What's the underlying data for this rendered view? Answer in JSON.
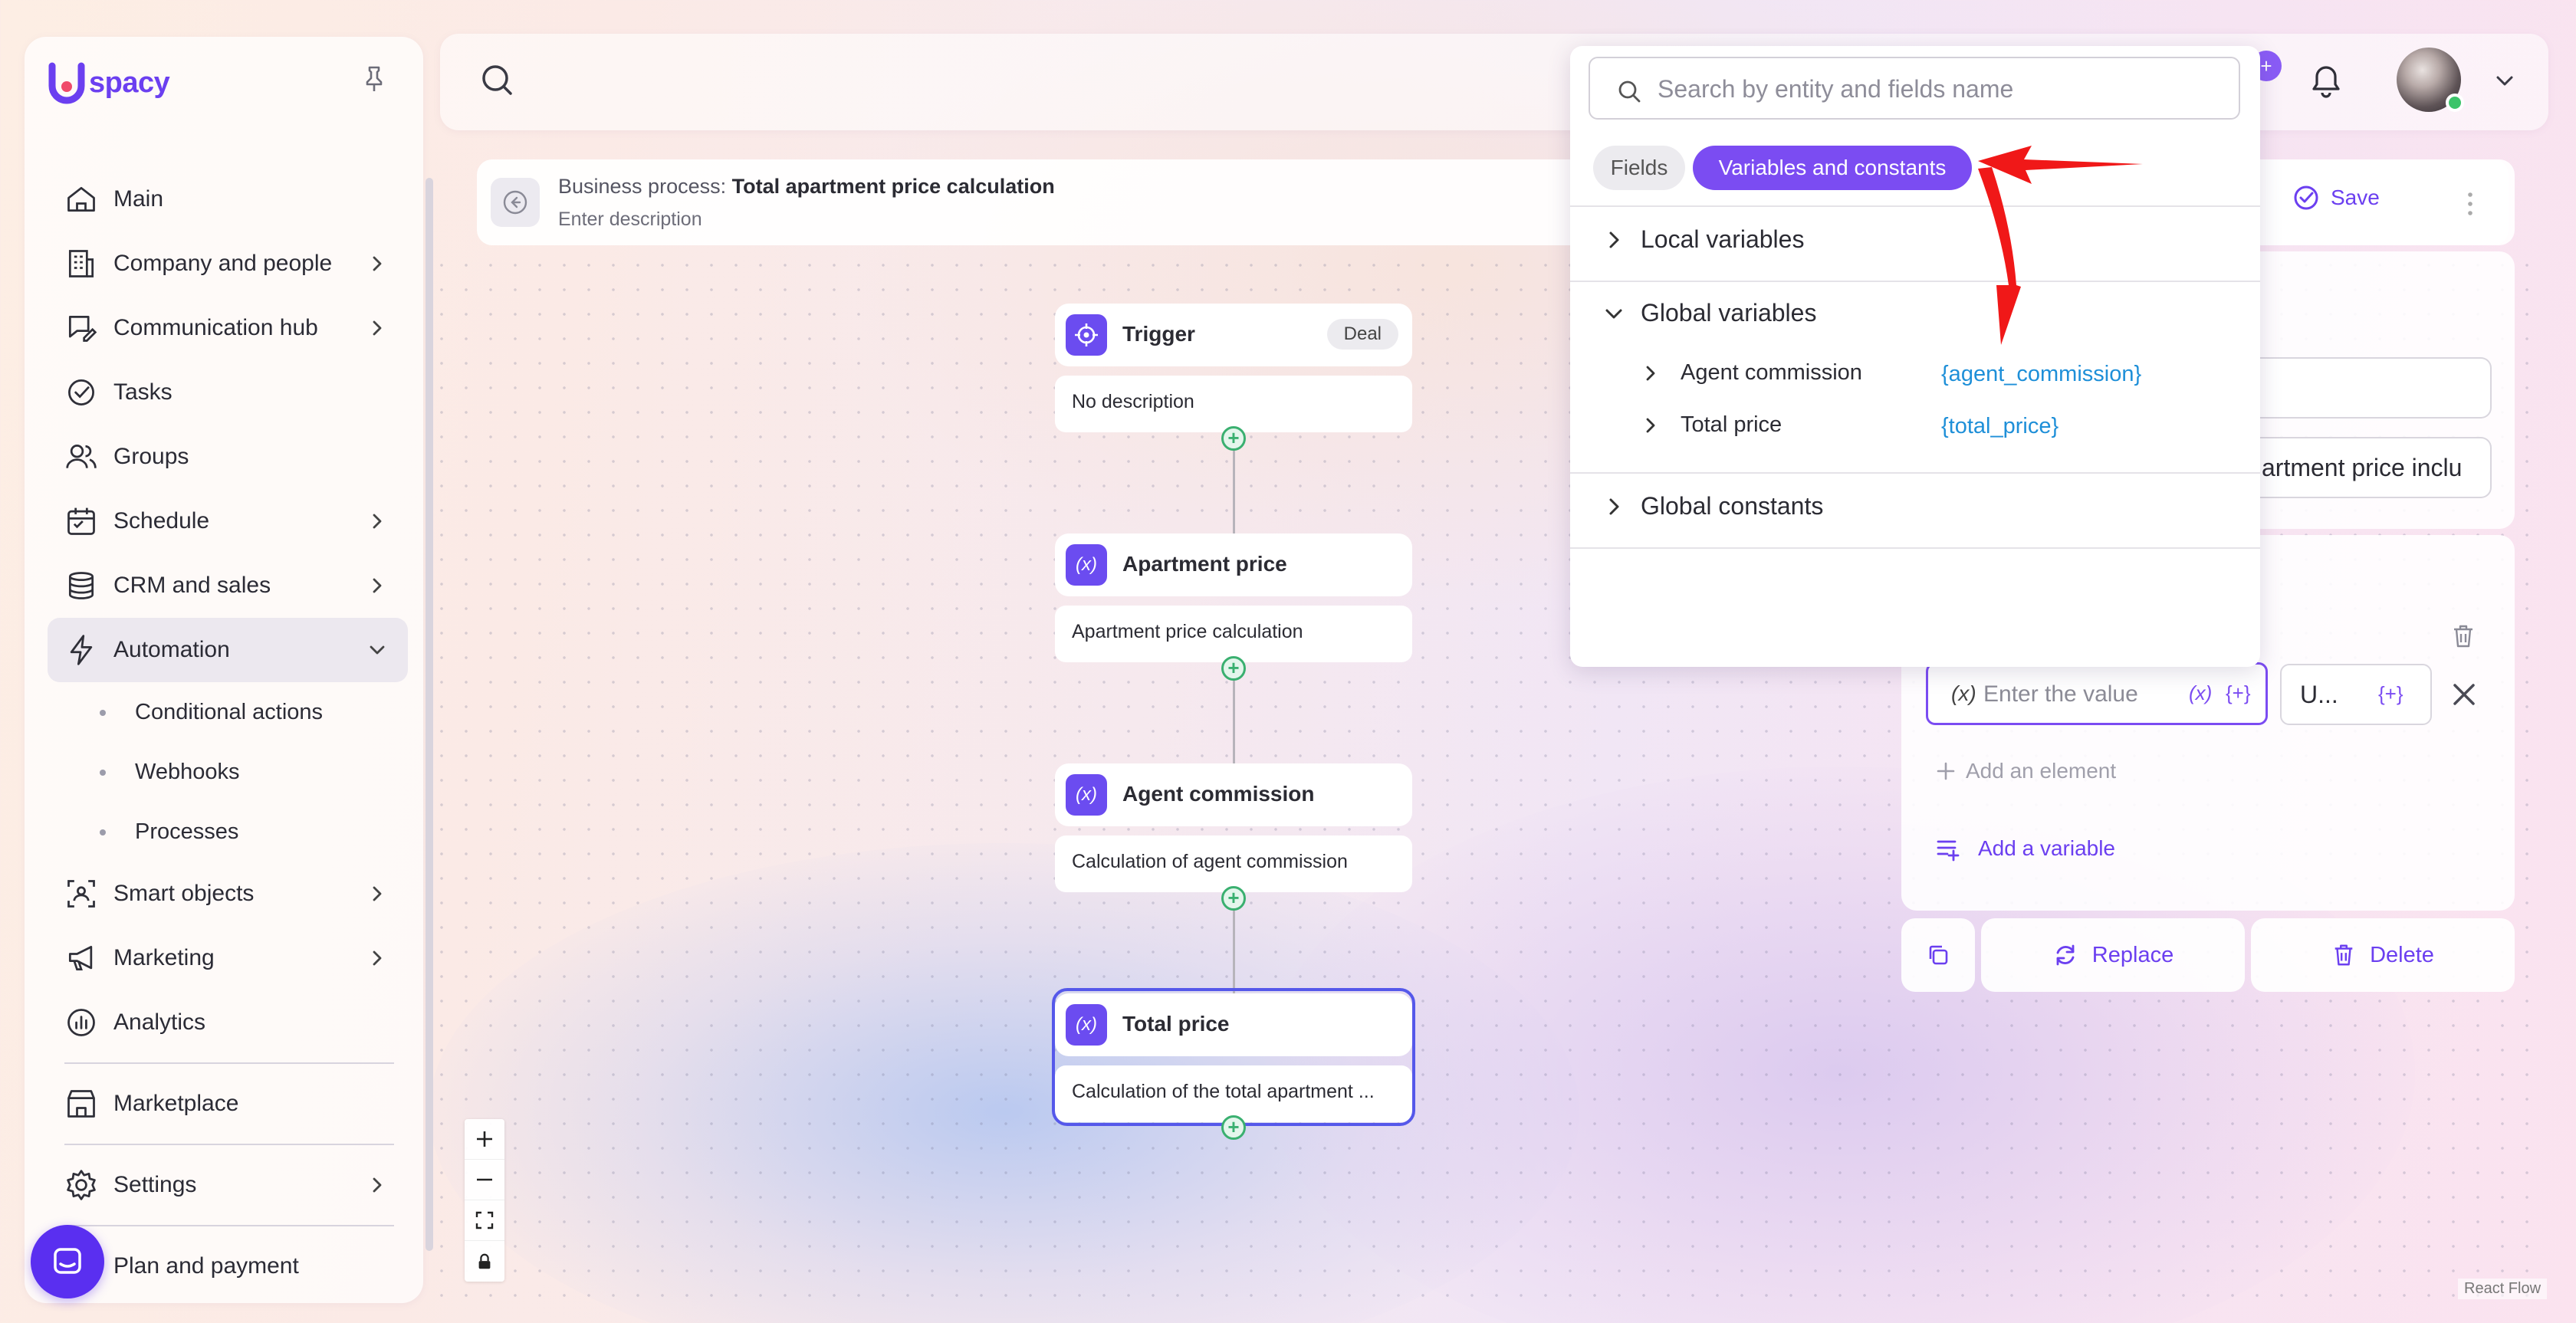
{
  "app": {
    "brand": "spacy",
    "accent": "#6b3ff0"
  },
  "sidebar": {
    "items": [
      {
        "label": "Main",
        "icon": "home-icon",
        "has_chevron": false
      },
      {
        "label": "Company and people",
        "icon": "building-icon",
        "has_chevron": true
      },
      {
        "label": "Communication hub",
        "icon": "chat-edit-icon",
        "has_chevron": true
      },
      {
        "label": "Tasks",
        "icon": "check-circle-icon",
        "has_chevron": false
      },
      {
        "label": "Groups",
        "icon": "users-icon",
        "has_chevron": false
      },
      {
        "label": "Schedule",
        "icon": "calendar-icon",
        "has_chevron": true
      },
      {
        "label": "CRM and sales",
        "icon": "database-icon",
        "has_chevron": true
      },
      {
        "label": "Automation",
        "icon": "lightning-icon",
        "has_chevron": true,
        "expanded": true
      }
    ],
    "automation_sub": [
      "Conditional actions",
      "Webhooks",
      "Processes"
    ],
    "items_after": [
      {
        "label": "Smart objects",
        "icon": "scan-icon",
        "has_chevron": true
      },
      {
        "label": "Marketing",
        "icon": "megaphone-icon",
        "has_chevron": true
      },
      {
        "label": "Analytics",
        "icon": "chart-icon",
        "has_chevron": false
      }
    ],
    "marketplace": "Marketplace",
    "settings": "Settings",
    "plan": "Plan and payment"
  },
  "process": {
    "prefix": "Business process:",
    "name": "Total apartment price calculation",
    "description": "Enter description"
  },
  "nodes": [
    {
      "title": "Trigger",
      "tag": "Deal",
      "body": "No description",
      "icon": "target-icon"
    },
    {
      "title": "Apartment price",
      "body": "Apartment price calculation",
      "icon": "variable-icon"
    },
    {
      "title": "Agent commission",
      "body": "Calculation of agent commission",
      "icon": "variable-icon"
    },
    {
      "title": "Total price",
      "body": "Calculation of the total apartment ...",
      "icon": "variable-icon",
      "selected": true
    }
  ],
  "right_panel": {
    "save": "Save",
    "field2_value": "artment price inclu",
    "value_placeholder": "Enter the value",
    "value_prefix": "(x)",
    "insert_var": "(x)",
    "insert_field": "{+}",
    "unit_value": "U...",
    "add_element": "Add an element",
    "add_variable": "Add a variable",
    "replace": "Replace",
    "delete": "Delete"
  },
  "dropdown": {
    "search_placeholder": "Search by entity and fields name",
    "tabs": [
      {
        "label": "Fields",
        "active": false
      },
      {
        "label": "Variables and constants",
        "active": true
      }
    ],
    "sections": {
      "local": "Local variables",
      "global": "Global variables",
      "constants": "Global constants"
    },
    "global_vars": [
      {
        "label": "Agent commission",
        "code": "{agent_commission}"
      },
      {
        "label": "Total price",
        "code": "{total_price}"
      }
    ]
  },
  "badge_plus": "+",
  "react_flow": "React Flow"
}
